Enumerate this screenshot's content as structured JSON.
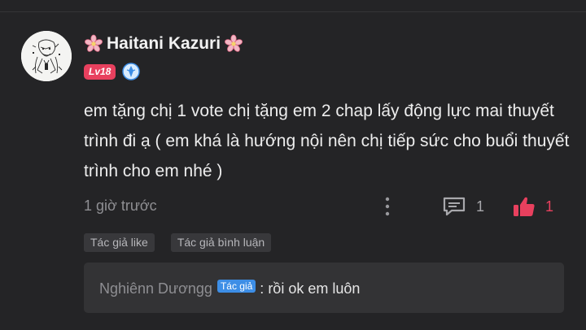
{
  "user": {
    "name": "Haitani Kazuri",
    "level": "Lv18"
  },
  "comment": {
    "text": "em tặng chị 1 vote chị tặng em 2 chap lấy động lực mai thuyết trình đi ạ ( em khá là hướng nội nên chị tiếp sức cho buổi thuyết trình cho em nhé )",
    "time": "1 giờ trước",
    "reply_count": "1",
    "like_count": "1"
  },
  "tags": [
    "Tác giả like",
    "Tác giả bình luận"
  ],
  "reply": {
    "name": "Nghiênn Dươngg",
    "badge": "Tác giả",
    "separator": ":",
    "text": "rồi ok em luôn"
  },
  "colors": {
    "accent": "#e8405e",
    "author_badge": "#3d8ee6",
    "background": "#242426"
  },
  "icons": [
    "flower-icon",
    "rank-icon",
    "more-icon",
    "comment-icon",
    "thumbs-up-icon"
  ]
}
